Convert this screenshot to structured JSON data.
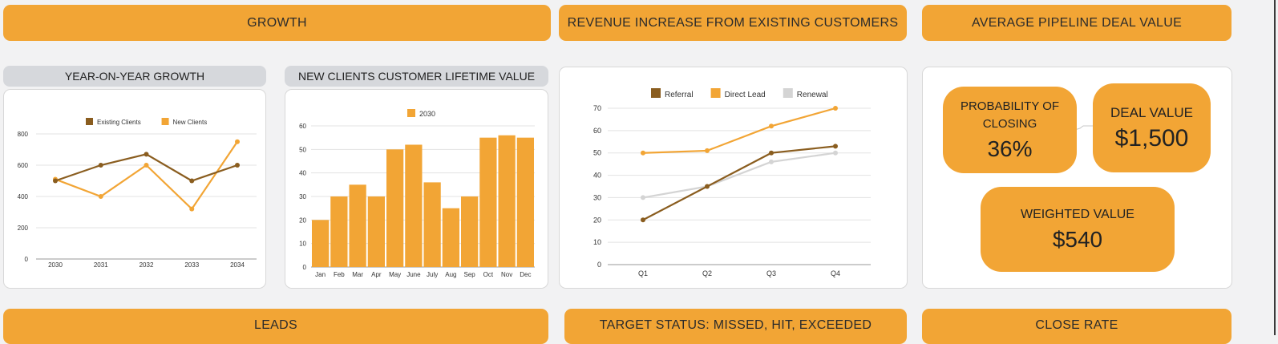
{
  "headers": {
    "growth": "GROWTH",
    "revenue": "REVENUE INCREASE FROM EXISTING CUSTOMERS",
    "pipeline": "AVERAGE PIPELINE DEAL VALUE",
    "leads": "LEADS",
    "target": "TARGET STATUS: MISSED, HIT, EXCEEDED",
    "close_rate": "CLOSE RATE"
  },
  "subheaders": {
    "yoy": "YEAR-ON-YEAR GROWTH",
    "clv": "NEW CLIENTS CUSTOMER LIFETIME VALUE"
  },
  "kpis": {
    "probability_label_1": "PROBABILITY OF",
    "probability_label_2": "CLOSING",
    "probability_value": "36%",
    "deal_label": "DEAL VALUE",
    "deal_value": "$1,500",
    "weighted_label": "WEIGHTED VALUE",
    "weighted_value": "$540"
  },
  "colors": {
    "accent": "#f2a535",
    "dark": "#8a5d1f",
    "grey": "#d4d4d4",
    "subheader_bg": "#d6d8dc"
  },
  "chart_data": [
    {
      "type": "line",
      "x": [
        "2030",
        "2031",
        "2032",
        "2033",
        "2034"
      ],
      "series": [
        {
          "name": "Existing Clients",
          "values": [
            500,
            600,
            670,
            500,
            600
          ],
          "color": "#8a5d1f"
        },
        {
          "name": "New Clients",
          "values": [
            510,
            400,
            600,
            320,
            750
          ],
          "color": "#f2a535"
        }
      ],
      "yticks": [
        0,
        200,
        400,
        600,
        800
      ],
      "ylim": [
        0,
        800
      ],
      "grid": true,
      "legend": "top"
    },
    {
      "type": "bar",
      "categories": [
        "Jan",
        "Feb",
        "Mar",
        "Apr",
        "May",
        "June",
        "July",
        "Aug",
        "Sep",
        "Oct",
        "Nov",
        "Dec"
      ],
      "series": [
        {
          "name": "2030",
          "values": [
            20,
            30,
            35,
            30,
            50,
            52,
            36,
            25,
            30,
            55,
            56,
            55
          ],
          "color": "#f2a535"
        }
      ],
      "yticks": [
        0,
        10,
        20,
        30,
        40,
        50,
        60
      ],
      "ylim": [
        0,
        60
      ],
      "grid": true,
      "legend": "top"
    },
    {
      "type": "line",
      "x": [
        "Q1",
        "Q2",
        "Q3",
        "Q4"
      ],
      "series": [
        {
          "name": "Referral",
          "values": [
            20,
            35,
            50,
            53
          ],
          "color": "#8a5d1f"
        },
        {
          "name": "Direct Lead",
          "values": [
            50,
            51,
            62,
            70
          ],
          "color": "#f2a535"
        },
        {
          "name": "Renewal",
          "values": [
            30,
            35,
            46,
            50
          ],
          "color": "#d4d4d4"
        }
      ],
      "yticks": [
        0,
        10,
        20,
        30,
        40,
        50,
        60,
        70
      ],
      "ylim": [
        0,
        70
      ],
      "grid": true,
      "legend": "top"
    }
  ]
}
